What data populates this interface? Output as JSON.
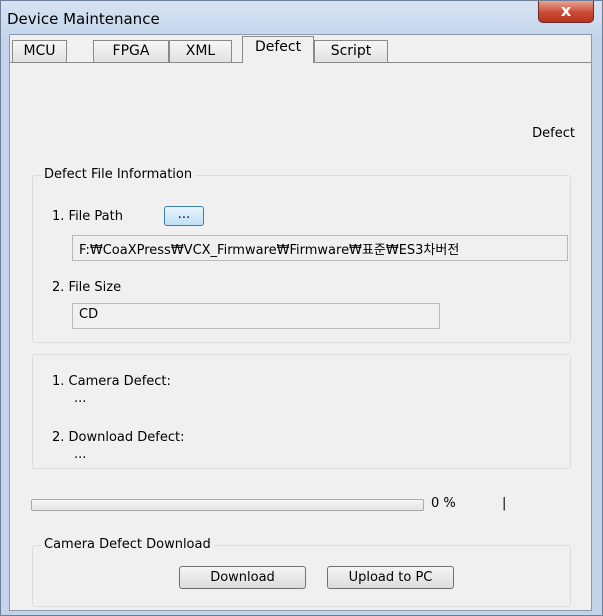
{
  "window": {
    "title": "Device Maintenance",
    "close_glyph": "x"
  },
  "tabs": [
    {
      "label": "MCU"
    },
    {
      "label": "FPGA"
    },
    {
      "label": "XML"
    },
    {
      "label": "Defect",
      "active": true
    },
    {
      "label": "Script"
    }
  ],
  "defect_panel": {
    "heading": "Defect",
    "file_info": {
      "group_title": "Defect File Information",
      "file_path_label": "1. File Path",
      "browse_button": "...",
      "file_path_value": "F:₩CoaXPress₩VCX_Firmware₩Firmware₩표준₩ES3차버전",
      "file_size_label": "2. File Size",
      "file_size_value": "CD"
    },
    "status": {
      "camera_defect_label": "1. Camera Defect:",
      "camera_defect_value": "...",
      "download_defect_label": "2. Download Defect:",
      "download_defect_value": "..."
    },
    "progress": {
      "value": 0,
      "text": "0 %",
      "trailing_mark": "|"
    },
    "download_group": {
      "group_title": "Camera Defect Download",
      "download_button": "Download",
      "upload_button": "Upload to PC"
    }
  }
}
